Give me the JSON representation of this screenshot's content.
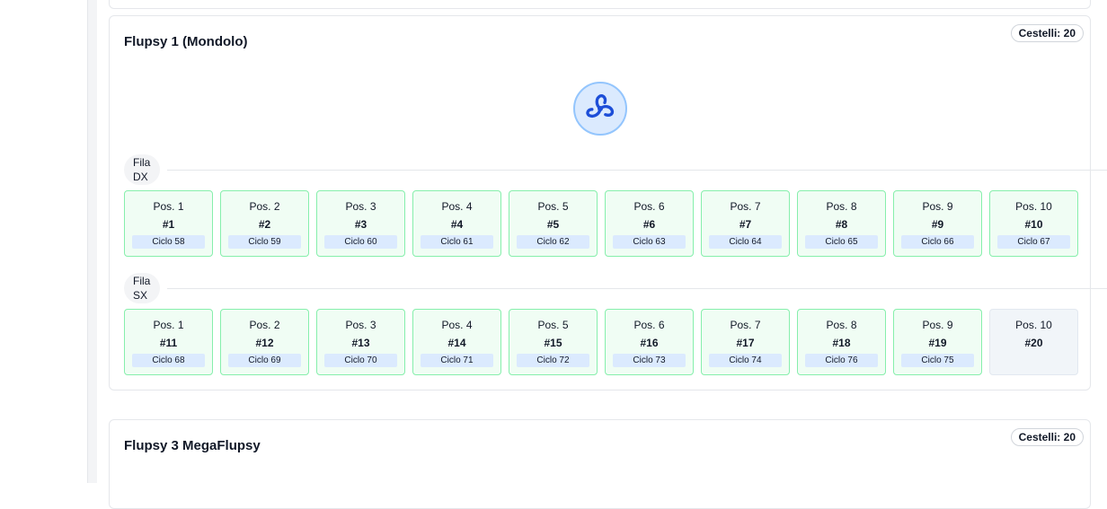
{
  "cards": [
    {
      "title": "Flupsy 1 (Mondolo)",
      "badge": "Cestelli: 20",
      "rows": [
        {
          "label_line1": "Fila",
          "label_line2": "DX",
          "cells": [
            {
              "pos": "Pos. 1",
              "num": "#1",
              "ciclo": "Ciclo 58"
            },
            {
              "pos": "Pos. 2",
              "num": "#2",
              "ciclo": "Ciclo 59"
            },
            {
              "pos": "Pos. 3",
              "num": "#3",
              "ciclo": "Ciclo 60"
            },
            {
              "pos": "Pos. 4",
              "num": "#4",
              "ciclo": "Ciclo 61"
            },
            {
              "pos": "Pos. 5",
              "num": "#5",
              "ciclo": "Ciclo 62"
            },
            {
              "pos": "Pos. 6",
              "num": "#6",
              "ciclo": "Ciclo 63"
            },
            {
              "pos": "Pos. 7",
              "num": "#7",
              "ciclo": "Ciclo 64"
            },
            {
              "pos": "Pos. 8",
              "num": "#8",
              "ciclo": "Ciclo 65"
            },
            {
              "pos": "Pos. 9",
              "num": "#9",
              "ciclo": "Ciclo 66"
            },
            {
              "pos": "Pos. 10",
              "num": "#10",
              "ciclo": "Ciclo 67"
            }
          ]
        },
        {
          "label_line1": "Fila",
          "label_line2": "SX",
          "cells": [
            {
              "pos": "Pos. 1",
              "num": "#11",
              "ciclo": "Ciclo 68"
            },
            {
              "pos": "Pos. 2",
              "num": "#12",
              "ciclo": "Ciclo 69"
            },
            {
              "pos": "Pos. 3",
              "num": "#13",
              "ciclo": "Ciclo 70"
            },
            {
              "pos": "Pos. 4",
              "num": "#14",
              "ciclo": "Ciclo 71"
            },
            {
              "pos": "Pos. 5",
              "num": "#15",
              "ciclo": "Ciclo 72"
            },
            {
              "pos": "Pos. 6",
              "num": "#16",
              "ciclo": "Ciclo 73"
            },
            {
              "pos": "Pos. 7",
              "num": "#17",
              "ciclo": "Ciclo 74"
            },
            {
              "pos": "Pos. 8",
              "num": "#18",
              "ciclo": "Ciclo 76"
            },
            {
              "pos": "Pos. 9",
              "num": "#19",
              "ciclo": "Ciclo 75"
            },
            {
              "pos": "Pos. 10",
              "num": "#20",
              "ciclo": ""
            }
          ]
        }
      ]
    },
    {
      "title": "Flupsy 3 MegaFlupsy",
      "badge": "Cestelli: 20"
    }
  ],
  "icons": {
    "propeller": "propeller-icon"
  },
  "colors": {
    "active_cell_bg": "#f0fdf4",
    "active_cell_border": "#86efac",
    "empty_cell_bg": "#f1f5f9",
    "ciclo_tag_bg": "#dbeafe",
    "propeller_circle": "#dbeafe",
    "propeller_stroke": "#1d4ed8"
  }
}
